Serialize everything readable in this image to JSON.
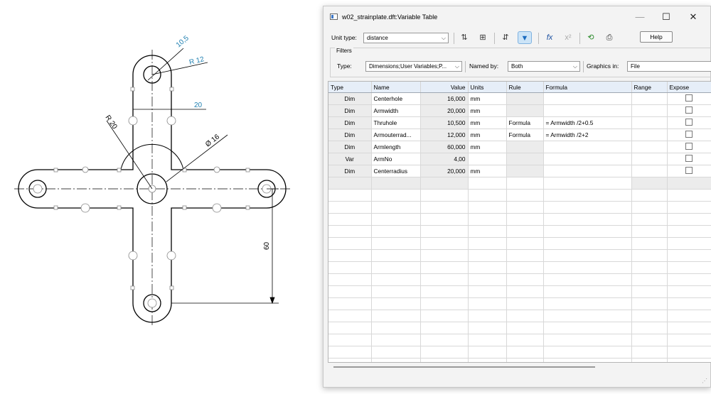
{
  "drawing": {
    "dim_10_5": "10,5",
    "dim_r12": "R 12",
    "dim_20": "20",
    "dim_r20": "R 20",
    "dim_phi": "Ø 16",
    "dim_60": "60"
  },
  "window": {
    "title": "w02_strainplate.dft:Variable Table",
    "minimize": "—",
    "maximize": "☐",
    "close": "✕"
  },
  "toolbar": {
    "unit_type_label": "Unit type:",
    "unit_type_value": "distance",
    "help_label": "Help"
  },
  "filters": {
    "group_label": "Filters",
    "type_label": "Type:",
    "type_value": "Dimensions;User Variables;P...",
    "named_by_label": "Named by:",
    "named_by_value": "Both",
    "graphics_in_label": "Graphics in:",
    "graphics_in_value": "File"
  },
  "table": {
    "headers": [
      "Type",
      "Name",
      "Value",
      "Units",
      "Rule",
      "Formula",
      "Range",
      "Expose"
    ],
    "rows": [
      {
        "type": "Dim",
        "name": "Centerhole",
        "value": "16,000",
        "units": "mm",
        "rule": "",
        "formula": ""
      },
      {
        "type": "Dim",
        "name": "Armwidth",
        "value": "20,000",
        "units": "mm",
        "rule": "",
        "formula": ""
      },
      {
        "type": "Dim",
        "name": "Thruhole",
        "value": "10,500",
        "units": "mm",
        "rule": "Formula",
        "formula": "= Armwidth /2+0.5"
      },
      {
        "type": "Dim",
        "name": "Armouterrad...",
        "value": "12,000",
        "units": "mm",
        "rule": "Formula",
        "formula": "= Armwidth /2+2"
      },
      {
        "type": "Dim",
        "name": "Armlength",
        "value": "60,000",
        "units": "mm",
        "rule": "",
        "formula": ""
      },
      {
        "type": "Var",
        "name": "ArmNo",
        "value": "4,00",
        "units": "",
        "rule": "",
        "formula": ""
      },
      {
        "type": "Dim",
        "name": "Centerradius",
        "value": "20,000",
        "units": "mm",
        "rule": "",
        "formula": ""
      }
    ]
  },
  "colors": {
    "accent": "#2a88c8",
    "header_bg": "#e6eef8",
    "dimension_text": "#1e7fb0"
  }
}
